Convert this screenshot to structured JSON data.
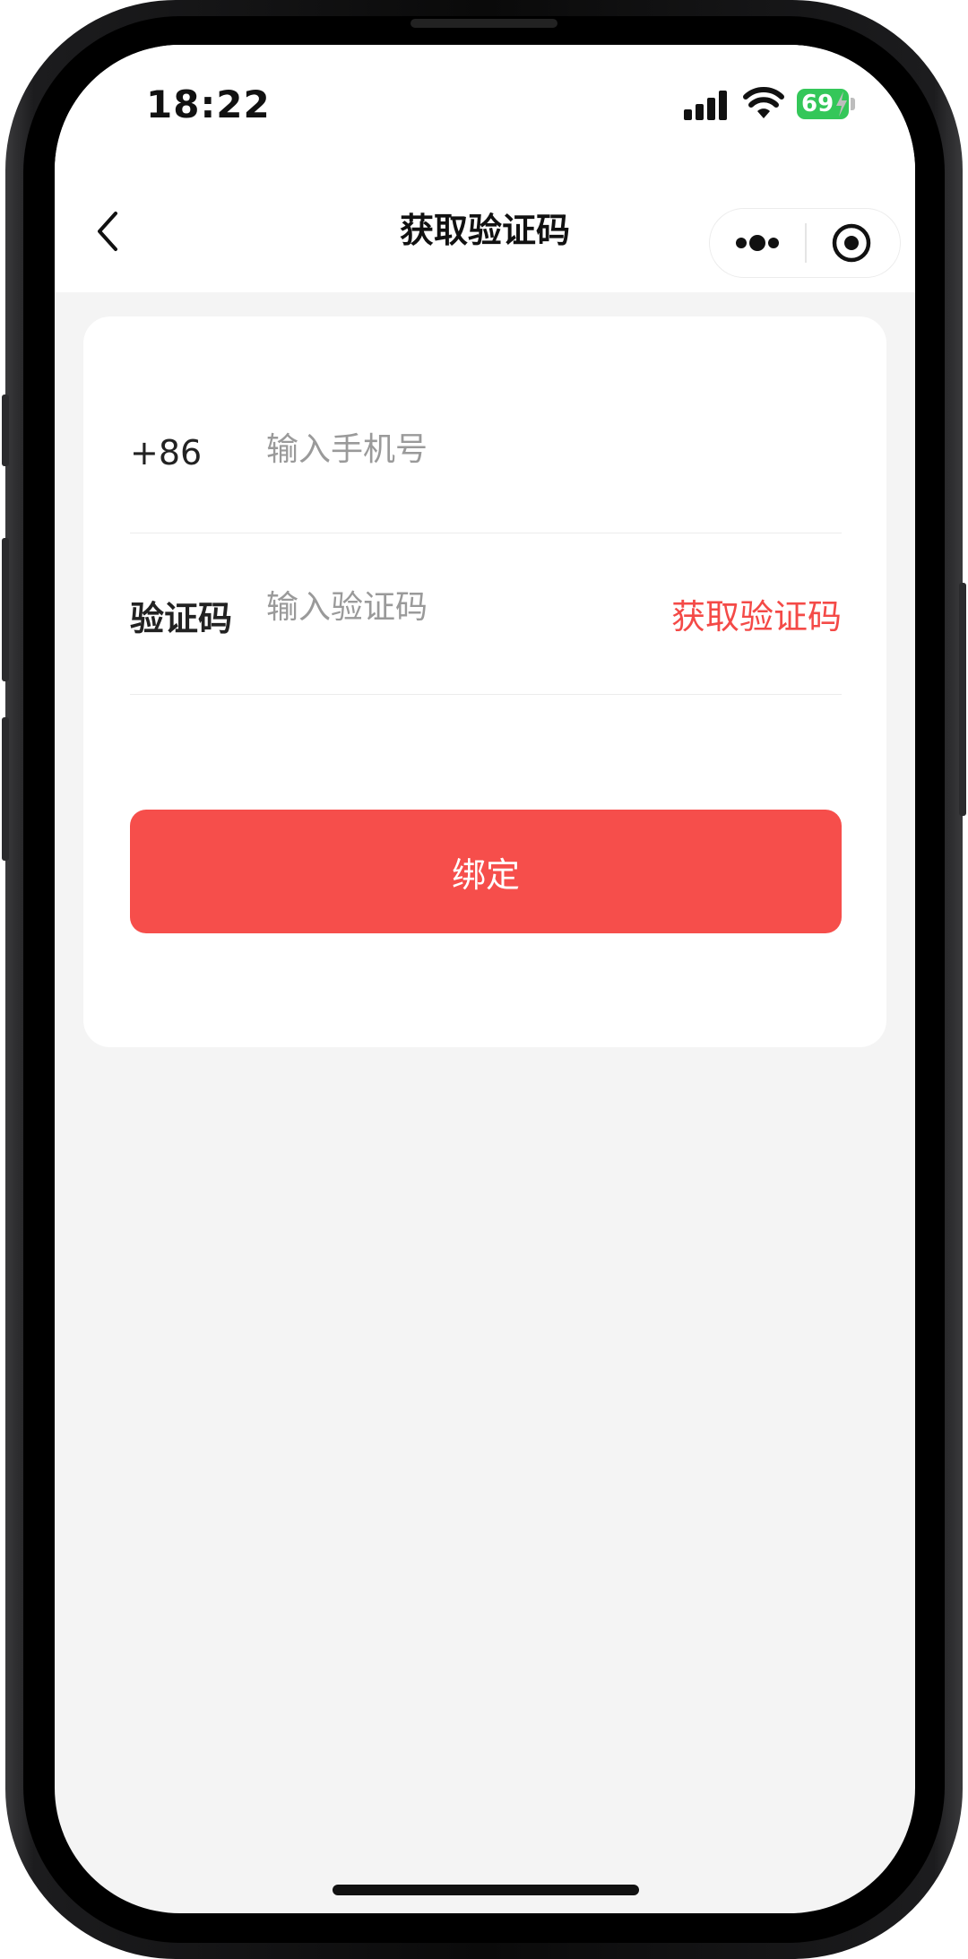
{
  "status_bar": {
    "time": "18:22",
    "battery": "69",
    "battery_color": "#34c759"
  },
  "nav": {
    "title": "获取验证码",
    "back_icon": "chevron-left-icon",
    "more_icon": "more-dots-icon",
    "close_icon": "target-circle-icon"
  },
  "form": {
    "country_code": "+86",
    "phone_placeholder": "输入手机号",
    "code_label": "验证码",
    "code_placeholder": "输入验证码",
    "get_code_label": "获取验证码",
    "bind_label": "绑定"
  },
  "colors": {
    "accent": "#f64e4b",
    "background": "#f4f4f4"
  }
}
